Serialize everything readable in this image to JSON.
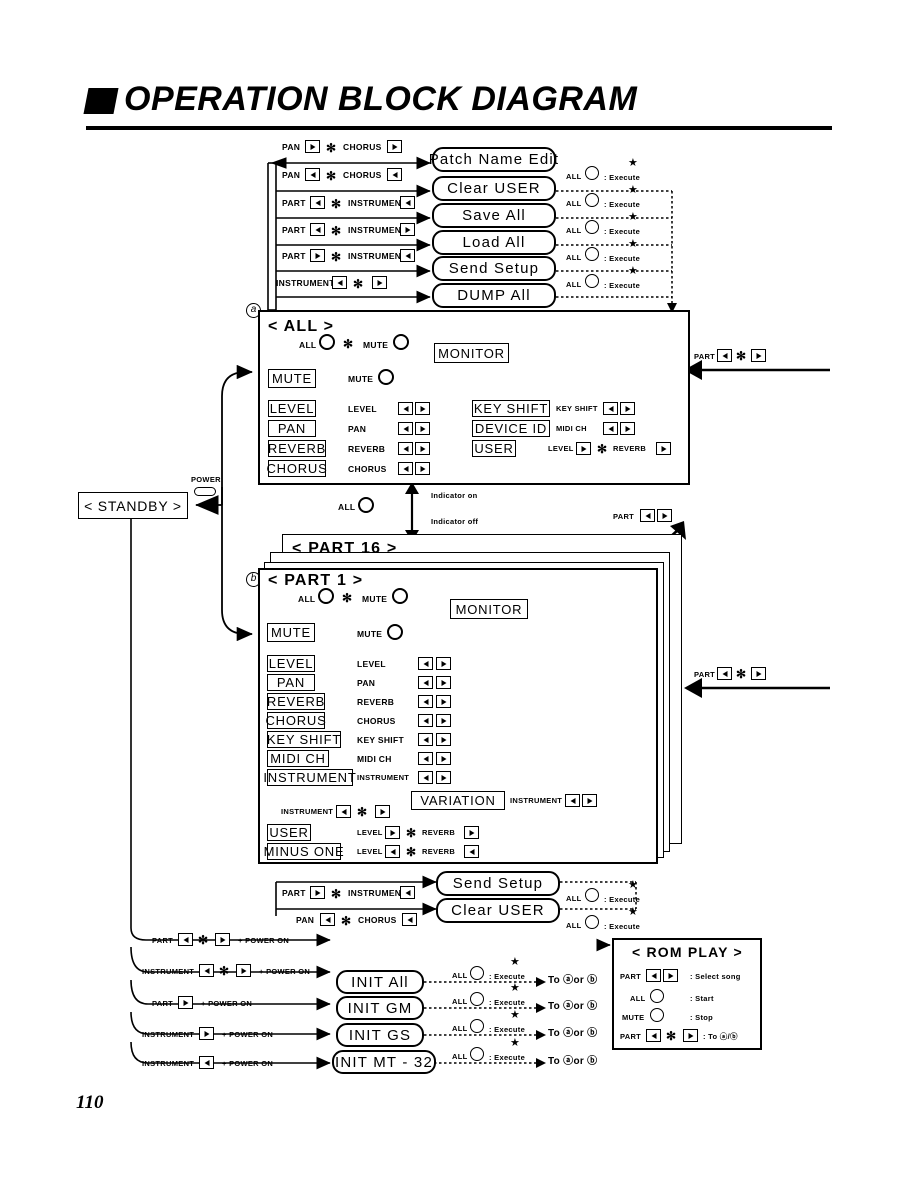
{
  "header": {
    "title": "OPERATION BLOCK DIAGRAM",
    "mark": "black-parallelogram"
  },
  "page_number": "110",
  "glyphs": {
    "asterisk": "✻",
    "plus": "+",
    "star": "★",
    "colon": ":",
    "a_marker": "a",
    "b_marker": "b"
  },
  "top_commands": {
    "rows": [
      {
        "combo": [
          "PAN",
          "right-key",
          "asterisk",
          "CHORUS",
          "right-key"
        ],
        "command": "Patch Name Edit",
        "exec": null
      },
      {
        "combo": [
          "PAN",
          "left-key",
          "asterisk",
          "CHORUS",
          "left-key"
        ],
        "command": "Clear  USER",
        "exec": {
          "knob": "ALL",
          "label": ": Execute"
        }
      },
      {
        "combo": [
          "PART",
          "left-key",
          "asterisk",
          "INSTRUMENT",
          "left-key"
        ],
        "command": "Save  All",
        "exec": {
          "knob": "ALL",
          "label": ": Execute"
        }
      },
      {
        "combo": [
          "PART",
          "left-key",
          "asterisk",
          "INSTRUMENT",
          "right-key"
        ],
        "command": "Load  All",
        "exec": {
          "knob": "ALL",
          "label": ": Execute"
        }
      },
      {
        "combo": [
          "PART",
          "right-key",
          "asterisk",
          "INSTRUMENT",
          "left-key"
        ],
        "command": "Send  Setup",
        "exec": {
          "knob": "ALL",
          "label": ": Execute"
        }
      },
      {
        "combo": [
          "INSTRUMENT",
          "left-key",
          "asterisk",
          "right-key"
        ],
        "command": "DUMP  All",
        "exec": {
          "knob": "ALL",
          "label": ": Execute"
        }
      }
    ],
    "labels": {
      "pan": "PAN",
      "chorus": "CHORUS",
      "part": "PART",
      "instrument": "INSTRUMENT",
      "all": "ALL",
      "execute": ": Execute"
    }
  },
  "all_panel": {
    "marker": "a",
    "title": "< ALL >",
    "top_row": {
      "all": "ALL",
      "mute": "MUTE"
    },
    "monitor": "MONITOR",
    "mute_button": "MUTE",
    "mute_knob_label": "MUTE",
    "left_column": [
      {
        "button": "LEVEL",
        "label": "LEVEL",
        "keys": [
          "left-key",
          "right-key"
        ]
      },
      {
        "button": "PAN",
        "label": "PAN",
        "keys": [
          "left-key",
          "right-key"
        ]
      },
      {
        "button": "REVERB",
        "label": "REVERB",
        "keys": [
          "left-key",
          "right-key"
        ]
      },
      {
        "button": "CHORUS",
        "label": "CHORUS",
        "keys": [
          "left-key",
          "right-key"
        ]
      }
    ],
    "right_column": [
      {
        "button": "KEY  SHIFT",
        "label": "KEY  SHIFT",
        "keys": [
          "left-key",
          "right-key"
        ]
      },
      {
        "button": "DEVICE  ID",
        "label": "MIDI  CH",
        "keys": [
          "left-key",
          "right-key"
        ]
      },
      {
        "button": "USER",
        "label": "LEVEL",
        "keys": [
          "right-key"
        ],
        "label2": "REVERB",
        "keys2": [
          "right-key"
        ],
        "sep": "asterisk"
      }
    ],
    "right_entry": {
      "part": "PART",
      "keys": [
        "left-key",
        "asterisk",
        "right-key"
      ]
    }
  },
  "standby": {
    "label": "< STANDBY >",
    "power_label": "POWER"
  },
  "indicator": {
    "knob": "ALL",
    "on": "Indicator  on",
    "off": "Indicator  off"
  },
  "part_select": {
    "part": "PART",
    "keys": [
      "left-key",
      "right-key"
    ]
  },
  "part16_panel": {
    "title": "< PART  16 >"
  },
  "part1_panel": {
    "marker": "b",
    "title": "< PART  1 >",
    "top_row": {
      "all": "ALL",
      "mute": "MUTE"
    },
    "monitor": "MONITOR",
    "mute_button": "MUTE",
    "mute_knob_label": "MUTE",
    "rows": [
      {
        "button": "LEVEL",
        "label": "LEVEL",
        "keys": [
          "left-key",
          "right-key"
        ]
      },
      {
        "button": "PAN",
        "label": "PAN",
        "keys": [
          "left-key",
          "right-key"
        ]
      },
      {
        "button": "REVERB",
        "label": "REVERB",
        "keys": [
          "left-key",
          "right-key"
        ]
      },
      {
        "button": "CHORUS",
        "label": "CHORUS",
        "keys": [
          "left-key",
          "right-key"
        ]
      },
      {
        "button": "KEY  SHIFT",
        "label": "KEY  SHIFT",
        "keys": [
          "left-key",
          "right-key"
        ]
      },
      {
        "button": "MIDI  CH",
        "label": "MIDI  CH",
        "keys": [
          "left-key",
          "right-key"
        ]
      },
      {
        "button": "INSTRUMENT",
        "label": "INSTRUMENT",
        "keys": [
          "left-key",
          "right-key"
        ]
      }
    ],
    "variation": {
      "combo_label": "INSTRUMENT",
      "combo_keys": [
        "left-key",
        "asterisk",
        "right-key"
      ],
      "button": "VARIATION",
      "right_label": "INSTRUMENT",
      "right_keys": [
        "left-key",
        "right-key"
      ]
    },
    "bottom_rows": [
      {
        "button": "USER",
        "label": "LEVEL",
        "key": "right-key",
        "sep": "asterisk",
        "label2": "REVERB",
        "key2": "right-key"
      },
      {
        "button": "MINUS  ONE",
        "label": "LEVEL",
        "key": "left-key",
        "sep": "asterisk",
        "label2": "REVERB",
        "key2": "left-key"
      }
    ],
    "right_entry": {
      "part": "PART",
      "keys": [
        "left-key",
        "asterisk",
        "right-key"
      ]
    }
  },
  "bottom_commands": {
    "rows": [
      {
        "combo": [
          "PART",
          "right-key",
          "asterisk",
          "INSTRUMENT",
          "left-key"
        ],
        "command": "Send  Setup",
        "exec": {
          "knob": "ALL",
          "label": ": Execute"
        }
      },
      {
        "combo": [
          "PAN",
          "left-key",
          "asterisk",
          "CHORUS",
          "left-key"
        ],
        "command": "Clear  USER",
        "exec": {
          "knob": "ALL",
          "label": ": Execute"
        }
      }
    ]
  },
  "init_commands": {
    "power_on": "POWER ON",
    "rows": [
      {
        "combo_label": "PART",
        "keys": [
          "left-key",
          "asterisk",
          "right-key"
        ],
        "suffix": "+  POWER ON",
        "command": null,
        "target": null
      },
      {
        "combo_label": "INSTRUMENT",
        "keys": [
          "left-key",
          "asterisk",
          "right-key"
        ],
        "suffix": "+  POWER ON",
        "command": "INIT  All",
        "exec": {
          "knob": "ALL",
          "label": ": Execute"
        },
        "target": "To ⓐor ⓑ"
      },
      {
        "combo_label": "PART",
        "keys": [
          "right-key"
        ],
        "suffix": "+  POWER ON",
        "command": "INIT  GM",
        "exec": {
          "knob": "ALL",
          "label": ": Execute"
        },
        "target": "To ⓐor ⓑ"
      },
      {
        "combo_label": "INSTRUMENT",
        "keys": [
          "right-key"
        ],
        "suffix": "+  POWER ON",
        "command": "INIT  GS",
        "exec": {
          "knob": "ALL",
          "label": ": Execute"
        },
        "target": "To ⓐor ⓑ"
      },
      {
        "combo_label": "INSTRUMENT",
        "keys": [
          "left-key"
        ],
        "suffix": "+  POWER ON",
        "command": "INIT  MT - 32",
        "exec": {
          "knob": "ALL",
          "label": ": Execute"
        },
        "target": "To ⓐor ⓑ"
      }
    ],
    "target_text": "To ⓐor ⓑ"
  },
  "rom_play": {
    "title": "< ROM  PLAY >",
    "rows": [
      {
        "control": "PART",
        "keys": [
          "left-key",
          "right-key"
        ],
        "action": ": Select  song"
      },
      {
        "control": "ALL",
        "knob": true,
        "action": ": Start"
      },
      {
        "control": "MUTE",
        "knob": true,
        "action": ": Stop"
      },
      {
        "control": "PART",
        "keys": [
          "left-key",
          "asterisk",
          "right-key"
        ],
        "action": ": To ⓐ/ⓑ"
      }
    ]
  },
  "colors": {
    "ink": "#000000",
    "paper": "#ffffff"
  }
}
